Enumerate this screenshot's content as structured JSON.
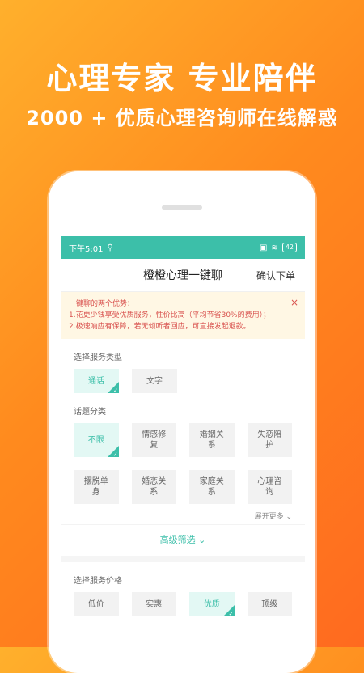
{
  "promo": {
    "headline": "心理专家  专业陪伴",
    "subline": "2000 + 优质心理咨询师在线解惑"
  },
  "status_bar": {
    "time": "下午5:01",
    "battery": "42"
  },
  "nav": {
    "title": "橙橙心理一键聊",
    "action": "确认下单"
  },
  "notice": {
    "title": "一键聊的两个优势：",
    "line1": "1.花更少钱享受优质服务，性价比高（平均节省30%的费用）；",
    "line2": "2.极速响应有保障，若无倾听者回应，可直接发起退款。",
    "close": "×"
  },
  "service_type": {
    "title": "选择服务类型",
    "options": [
      "通话",
      "文字"
    ],
    "selected": "通话"
  },
  "topic": {
    "title": "话题分类",
    "options": [
      "不限",
      "情感修复",
      "婚姻关系",
      "失恋陪护",
      "摆脱单身",
      "婚恋关系",
      "家庭关系",
      "心理咨询"
    ],
    "selected": "不限",
    "expand": "展开更多",
    "expand_icon": "chevron-down"
  },
  "filter": {
    "label": "高级筛选",
    "icon": "chevron-down"
  },
  "price": {
    "title": "选择服务价格",
    "options": [
      "低价",
      "实惠",
      "优质",
      "顶级"
    ],
    "selected": "优质"
  },
  "colors": {
    "accent": "#3cbfa9",
    "background_orange": "#ff8a1e"
  }
}
